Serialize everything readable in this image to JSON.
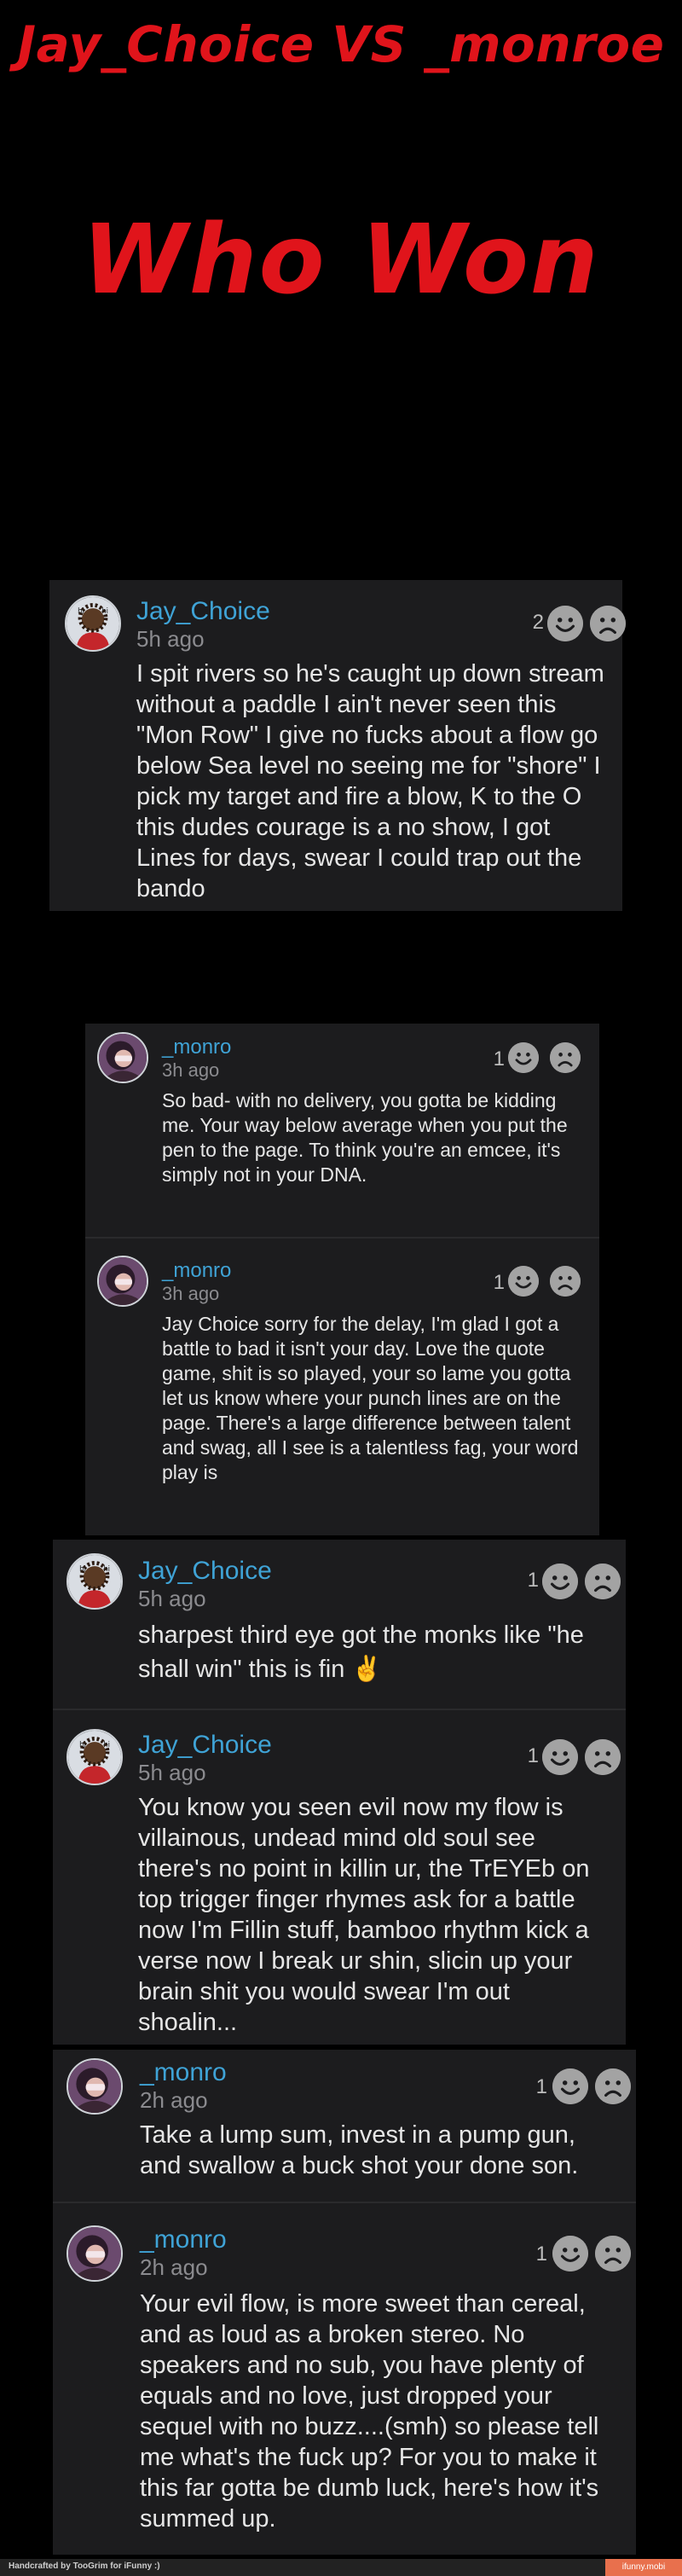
{
  "header": {
    "title": "Jay_Choice VS _monroe",
    "subtitle": "Who Won"
  },
  "cards": [
    {
      "comments": [
        {
          "username": "Jay_Choice",
          "time": "5h ago",
          "likes": "2",
          "text": "I spit rivers so he's caught up down stream without a paddle I ain't never seen this \"Mon Row\" I give no fucks about a flow go below Sea level no seeing me for \"shore\" I pick my target and fire a blow, K to the O this dudes courage is a no show, I got Lines for days, swear I could trap out the bando"
        }
      ]
    },
    {
      "comments": [
        {
          "username": "_monro",
          "time": "3h ago",
          "likes": "1",
          "text": "So bad- with no delivery, you gotta be kidding me. Your way below average when you put the pen to the page. To think you're an emcee, it's simply not in your DNA."
        },
        {
          "username": "_monro",
          "time": "3h ago",
          "likes": "1",
          "text": "Jay Choice sorry for the delay, I'm glad I got a battle to bad it isn't your day. Love the quote game, shit is so played, your so lame you gotta let us know where your punch lines are on the page. There's a large difference between talent and swag, all I see is a talentless fag, your word play is"
        }
      ]
    },
    {
      "comments": [
        {
          "username": "Jay_Choice",
          "time": "5h ago",
          "likes": "1",
          "text": "sharpest third eye got the monks like \"he shall win\" this is fin ✌️"
        },
        {
          "username": "Jay_Choice",
          "time": "5h ago",
          "likes": "1",
          "text": "You know you seen evil now my flow is villainous, undead mind old soul see there's no point in killin ur, the TrEYEb on top trigger finger rhymes ask for a battle now I'm Fillin stuff, bamboo rhythm kick a verse now I break ur shin, slicin up your brain shit you would swear I'm out shoalin..."
        }
      ]
    },
    {
      "comments": [
        {
          "username": "_monro",
          "time": "2h ago",
          "likes": "1",
          "text": "Take a lump sum, invest in a pump gun, and swallow a buck shot your done son."
        },
        {
          "username": "_monro",
          "time": "2h ago",
          "likes": "1",
          "text": "Your evil flow, is more sweet than cereal, and as loud as a broken stereo. No speakers and no sub, you have plenty of equals and no love, just dropped your sequel with no buzz....(smh) so please tell me what's the fuck up? For you to make it this far gotta be dumb luck, here's how it's summed up."
        }
      ]
    }
  ],
  "footer": {
    "credit": "Handcrafted by TooGrim for iFunny :)",
    "brand": "ifunny.mobi"
  },
  "colors": {
    "title_red": "#e0141b",
    "username_blue": "#3fa3d6",
    "card_bg": "#1c1c1e"
  },
  "icons": [
    "smile-icon",
    "frown-icon",
    "avatar-jay",
    "avatar-monro",
    "victory-hand-icon"
  ]
}
